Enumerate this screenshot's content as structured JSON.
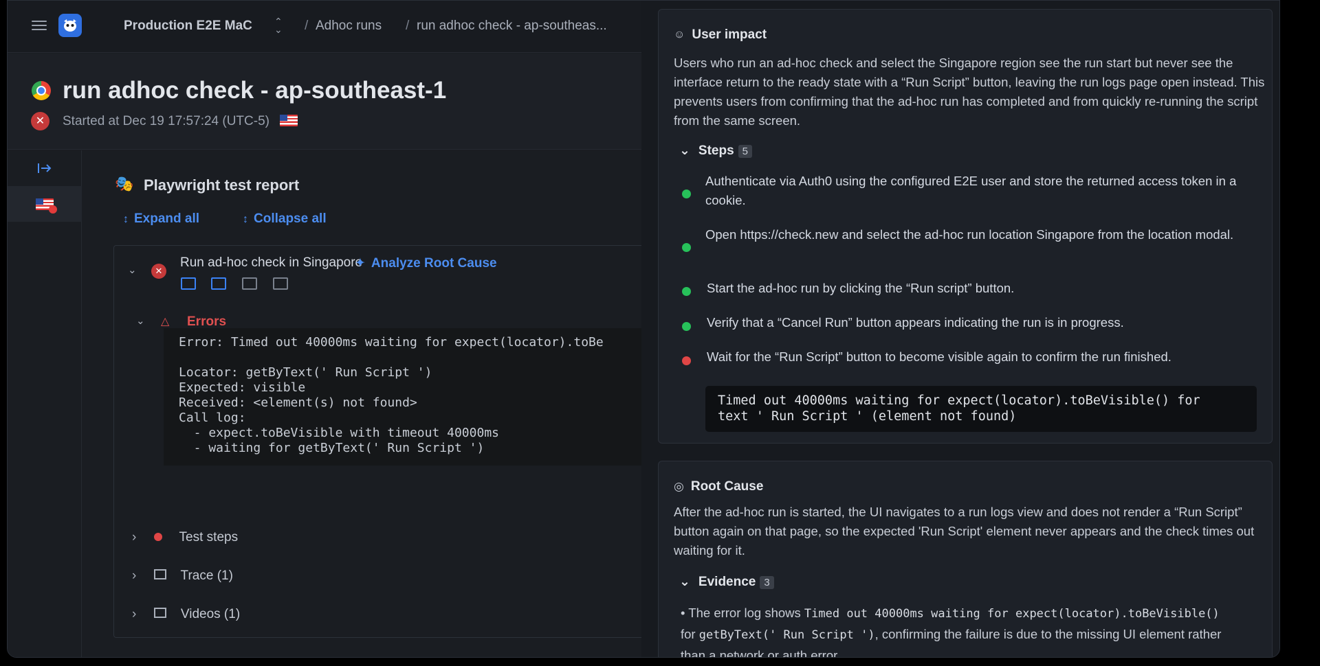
{
  "breadcrumb": {
    "project": "Production E2E MaC",
    "section": "Adhoc runs",
    "current": "run adhoc check - ap-southeas..."
  },
  "header": {
    "title": "run adhoc check - ap-southeast-1",
    "started": "Started at Dec 19 17:57:24 (UTC-5)"
  },
  "report": {
    "title": "Playwright test report",
    "expand_all": "Expand all",
    "collapse_all": "Collapse all",
    "test_name": "Run ad-hoc check in Singapore",
    "analyze": "Analyze Root Cause",
    "errors_label": "Errors",
    "error_text": "Error: Timed out 40000ms waiting for expect(locator).toBe\n\nLocator: getByText(' Run Script ')\nExpected: visible\nReceived: <element(s) not found>\nCall log:\n  - expect.toBeVisible with timeout 40000ms\n  - waiting for getByText(' Run Script ')",
    "sections": [
      "Test steps",
      "Trace (1)",
      "Videos (1)"
    ]
  },
  "user_impact": {
    "title": "User impact",
    "text": "Users who run an ad-hoc check and select the Singapore region see the run start but never see the interface return to the ready state with a “Run Script” button, leaving the run logs page open instead. This prevents users from confirming that the ad-hoc run has completed and from quickly re-running the script from the same screen.",
    "steps_label": "Steps",
    "steps_count": "5",
    "steps": [
      {
        "text": "Authenticate via Auth0 using the configured E2E user and store the returned access token in a cookie.",
        "status": "pass"
      },
      {
        "text": "Open https://check.new and select the ad-hoc run location Singapore from the location modal.",
        "status": "pass"
      },
      {
        "text": "Start the ad-hoc run by clicking the “Run script” button.",
        "status": "pass"
      },
      {
        "text": "Verify that a “Cancel Run” button appears indicating the run is in progress.",
        "status": "pass"
      },
      {
        "text": "Wait for the “Run Script” button to become visible again to confirm the run finished.",
        "status": "fail"
      }
    ],
    "step_error": "Timed out 40000ms waiting for expect(locator).toBeVisible() for\ntext ' Run Script ' (element not found)"
  },
  "root_cause": {
    "title": "Root Cause",
    "text": "After the ad-hoc run is started, the UI navigates to a run logs view and does not render a “Run Script” button again on that page, so the expected 'Run Script' element never appears and the check times out waiting for it.",
    "evidence_label": "Evidence",
    "evidence_count": "3",
    "evidence": {
      "prefix": "The error log shows",
      "code1": "Timed out 40000ms waiting for expect(locator).toBeVisible()",
      "mid": "for",
      "code2": "getByText(' Run Script ')",
      "suffix": ", confirming the failure is due to the missing UI element rather than a network or auth error."
    }
  },
  "colors": {
    "accent": "#4c8df0",
    "fail": "#e04646",
    "pass": "#27c15a"
  }
}
